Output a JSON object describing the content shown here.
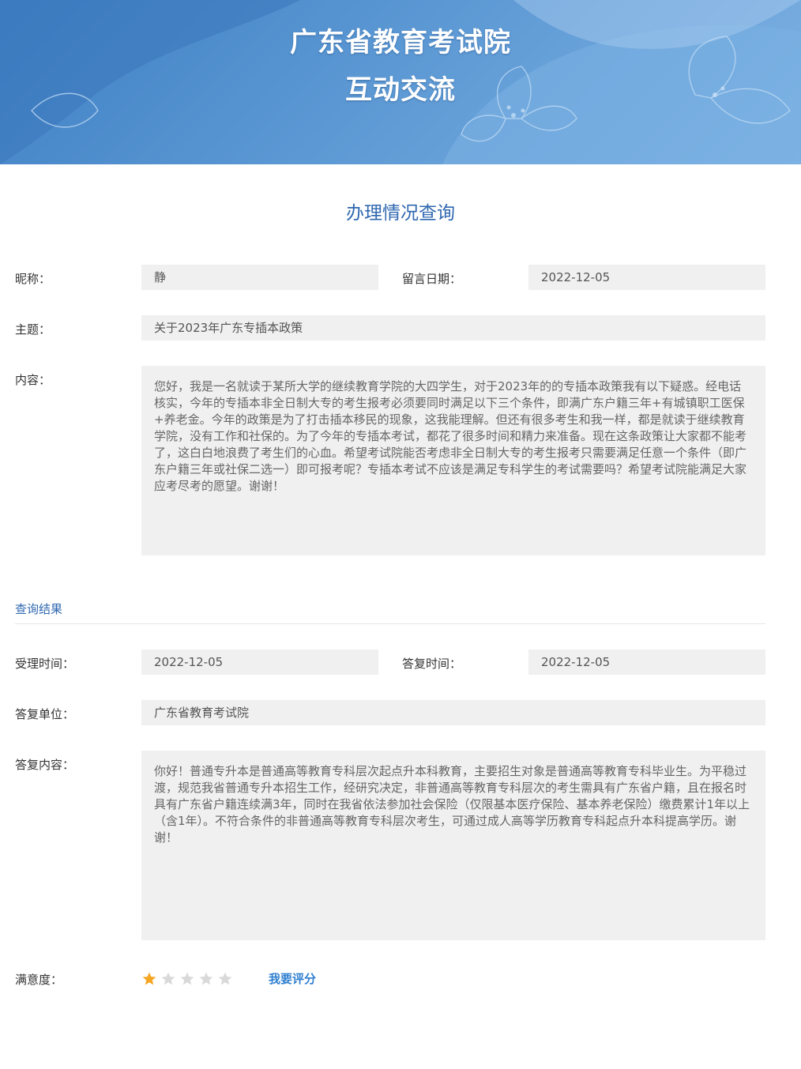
{
  "header": {
    "title_line1": "广东省教育考试院",
    "title_line2": "互动交流"
  },
  "page_title": "办理情况查询",
  "query": {
    "nickname_label": "昵称：",
    "nickname": "静",
    "date_label": "留言日期：",
    "date": "2022-12-05",
    "subject_label": "主题：",
    "subject": "关于2023年广东专插本政策",
    "content_label": "内容：",
    "content": "您好，我是一名就读于某所大学的继续教育学院的大四学生，对于2023年的的专插本政策我有以下疑惑。经电话核实，今年的专插本非全日制大专的考生报考必须要同时满足以下三个条件，即满广东户籍三年+有城镇职工医保+养老金。今年的政策是为了打击插本移民的现象，这我能理解。但还有很多考生和我一样，都是就读于继续教育学院，没有工作和社保的。为了今年的专插本考试，都花了很多时间和精力来准备。现在这条政策让大家都不能考了，这白白地浪费了考生们的心血。希望考试院能否考虑非全日制大专的考生报考只需要满足任意一个条件（即广东户籍三年或社保二选一）即可报考呢？专插本考试不应该是满足专科学生的考试需要吗？希望考试院能满足大家应考尽考的愿望。谢谢！"
  },
  "result": {
    "heading": "查询结果",
    "accept_time_label": "受理时间：",
    "accept_time": "2022-12-05",
    "reply_time_label": "答复时间：",
    "reply_time": "2022-12-05",
    "reply_unit_label": "答复单位：",
    "reply_unit": "广东省教育考试院",
    "reply_content_label": "答复内容：",
    "reply_content": "你好！普通专升本是普通高等教育专科层次起点升本科教育，主要招生对象是普通高等教育专科毕业生。为平稳过渡，规范我省普通专升本招生工作，经研究决定，非普通高等教育专科层次的考生需具有广东省户籍，且在报名时具有广东省户籍连续满3年，同时在我省依法参加社会保险（仅限基本医疗保险、基本养老保险）缴费累计1年以上（含1年）。不符合条件的非普通高等教育专科层次考生，可通过成人高等学历教育专科起点升本科提高学历。谢谢！",
    "satisfaction_label": "满意度：",
    "rating": 1,
    "rating_max": 5,
    "rate_link": "我要评分"
  },
  "colors": {
    "accent": "#2f68b0",
    "link": "#2f7fd0",
    "star_on": "#f5a623",
    "star_off": "#d9d9d9",
    "field_bg": "#f0f0f0"
  }
}
